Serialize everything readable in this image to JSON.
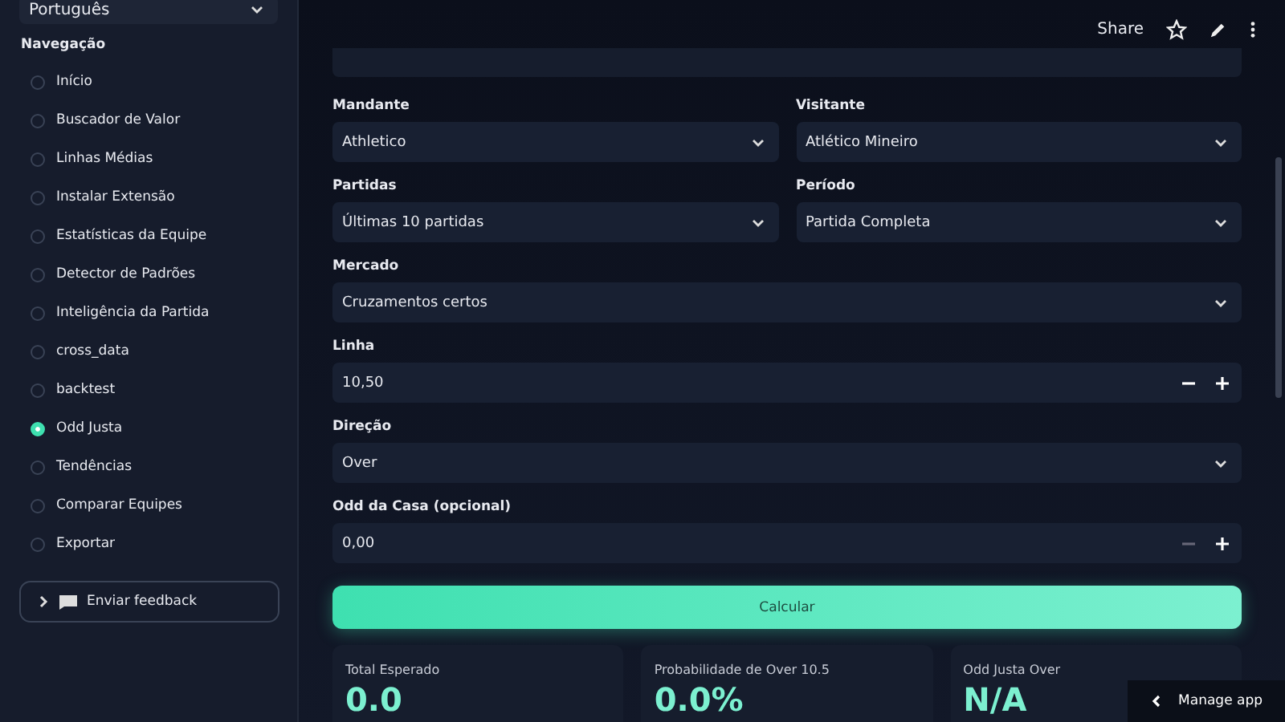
{
  "sidebar": {
    "language_select": {
      "value": "Português"
    },
    "nav_title": "Navegação",
    "nav_items": [
      {
        "label": "Início",
        "selected": false
      },
      {
        "label": "Buscador de Valor",
        "selected": false
      },
      {
        "label": "Linhas Médias",
        "selected": false
      },
      {
        "label": "Instalar Extensão",
        "selected": false
      },
      {
        "label": "Estatísticas da Equipe",
        "selected": false
      },
      {
        "label": "Detector de Padrões",
        "selected": false
      },
      {
        "label": "Inteligência da Partida",
        "selected": false
      },
      {
        "label": "cross_data",
        "selected": false
      },
      {
        "label": "backtest",
        "selected": false
      },
      {
        "label": "Odd Justa",
        "selected": true
      },
      {
        "label": "Tendências",
        "selected": false
      },
      {
        "label": "Comparar Equipes",
        "selected": false
      },
      {
        "label": "Exportar",
        "selected": false
      }
    ],
    "feedback_button": "Enviar feedback"
  },
  "header": {
    "share": "Share"
  },
  "form": {
    "rows": [
      [
        {
          "kind": "select",
          "label": "Mandante",
          "value": "Athletico"
        },
        {
          "kind": "select",
          "label": "Visitante",
          "value": "Atlético Mineiro"
        }
      ],
      [
        {
          "kind": "select",
          "label": "Partidas",
          "value": "Últimas 10 partidas"
        },
        {
          "kind": "select",
          "label": "Período",
          "value": "Partida Completa"
        }
      ],
      [
        {
          "kind": "select",
          "label": "Mercado",
          "value": "Cruzamentos certos"
        }
      ],
      [
        {
          "kind": "number",
          "label": "Linha",
          "value": "10,50",
          "minus_disabled": false
        }
      ],
      [
        {
          "kind": "select",
          "label": "Direção",
          "value": "Over"
        }
      ],
      [
        {
          "kind": "number",
          "label": "Odd da Casa (opcional)",
          "value": "0,00",
          "minus_disabled": true
        }
      ]
    ],
    "submit": "Calcular"
  },
  "metrics": [
    {
      "label": "Total Esperado",
      "value": "0.0"
    },
    {
      "label": "Probabilidade de Over 10.5",
      "value": "0.0%"
    },
    {
      "label": "Odd Justa Over",
      "value": "N/A"
    }
  ],
  "manage_app": "Manage app"
}
